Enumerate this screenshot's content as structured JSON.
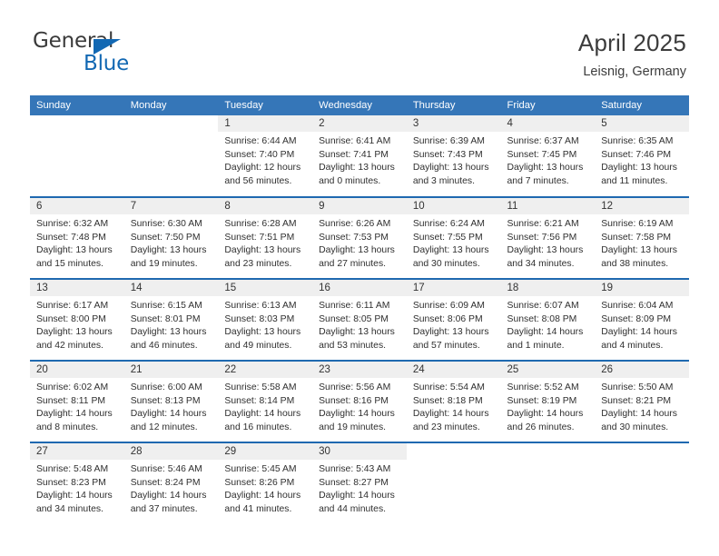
{
  "logo": {
    "word_one": "General",
    "word_two": "Blue",
    "triangle_color": "#1268b3"
  },
  "header": {
    "title": "April 2025",
    "subtitle": "Leisnig, Germany",
    "header_bg": "#3576b8",
    "row_divider_color": "#1f69b0",
    "daynum_bg": "#efefef"
  },
  "weekday_headers": [
    "Sunday",
    "Monday",
    "Tuesday",
    "Wednesday",
    "Thursday",
    "Friday",
    "Saturday"
  ],
  "labels": {
    "sunrise_prefix": "Sunrise:",
    "sunset_prefix": "Sunset:",
    "daylight_prefix": "Daylight:"
  },
  "weeks": [
    [
      {
        "day": "",
        "sunrise": "",
        "sunset": "",
        "daylight_line1": "",
        "daylight_line2": "",
        "empty": true
      },
      {
        "day": "",
        "sunrise": "",
        "sunset": "",
        "daylight_line1": "",
        "daylight_line2": "",
        "empty": true
      },
      {
        "day": "1",
        "sunrise": "Sunrise: 6:44 AM",
        "sunset": "Sunset: 7:40 PM",
        "daylight_line1": "Daylight: 12 hours",
        "daylight_line2": "and 56 minutes."
      },
      {
        "day": "2",
        "sunrise": "Sunrise: 6:41 AM",
        "sunset": "Sunset: 7:41 PM",
        "daylight_line1": "Daylight: 13 hours",
        "daylight_line2": "and 0 minutes."
      },
      {
        "day": "3",
        "sunrise": "Sunrise: 6:39 AM",
        "sunset": "Sunset: 7:43 PM",
        "daylight_line1": "Daylight: 13 hours",
        "daylight_line2": "and 3 minutes."
      },
      {
        "day": "4",
        "sunrise": "Sunrise: 6:37 AM",
        "sunset": "Sunset: 7:45 PM",
        "daylight_line1": "Daylight: 13 hours",
        "daylight_line2": "and 7 minutes."
      },
      {
        "day": "5",
        "sunrise": "Sunrise: 6:35 AM",
        "sunset": "Sunset: 7:46 PM",
        "daylight_line1": "Daylight: 13 hours",
        "daylight_line2": "and 11 minutes."
      }
    ],
    [
      {
        "day": "6",
        "sunrise": "Sunrise: 6:32 AM",
        "sunset": "Sunset: 7:48 PM",
        "daylight_line1": "Daylight: 13 hours",
        "daylight_line2": "and 15 minutes."
      },
      {
        "day": "7",
        "sunrise": "Sunrise: 6:30 AM",
        "sunset": "Sunset: 7:50 PM",
        "daylight_line1": "Daylight: 13 hours",
        "daylight_line2": "and 19 minutes."
      },
      {
        "day": "8",
        "sunrise": "Sunrise: 6:28 AM",
        "sunset": "Sunset: 7:51 PM",
        "daylight_line1": "Daylight: 13 hours",
        "daylight_line2": "and 23 minutes."
      },
      {
        "day": "9",
        "sunrise": "Sunrise: 6:26 AM",
        "sunset": "Sunset: 7:53 PM",
        "daylight_line1": "Daylight: 13 hours",
        "daylight_line2": "and 27 minutes."
      },
      {
        "day": "10",
        "sunrise": "Sunrise: 6:24 AM",
        "sunset": "Sunset: 7:55 PM",
        "daylight_line1": "Daylight: 13 hours",
        "daylight_line2": "and 30 minutes."
      },
      {
        "day": "11",
        "sunrise": "Sunrise: 6:21 AM",
        "sunset": "Sunset: 7:56 PM",
        "daylight_line1": "Daylight: 13 hours",
        "daylight_line2": "and 34 minutes."
      },
      {
        "day": "12",
        "sunrise": "Sunrise: 6:19 AM",
        "sunset": "Sunset: 7:58 PM",
        "daylight_line1": "Daylight: 13 hours",
        "daylight_line2": "and 38 minutes."
      }
    ],
    [
      {
        "day": "13",
        "sunrise": "Sunrise: 6:17 AM",
        "sunset": "Sunset: 8:00 PM",
        "daylight_line1": "Daylight: 13 hours",
        "daylight_line2": "and 42 minutes."
      },
      {
        "day": "14",
        "sunrise": "Sunrise: 6:15 AM",
        "sunset": "Sunset: 8:01 PM",
        "daylight_line1": "Daylight: 13 hours",
        "daylight_line2": "and 46 minutes."
      },
      {
        "day": "15",
        "sunrise": "Sunrise: 6:13 AM",
        "sunset": "Sunset: 8:03 PM",
        "daylight_line1": "Daylight: 13 hours",
        "daylight_line2": "and 49 minutes."
      },
      {
        "day": "16",
        "sunrise": "Sunrise: 6:11 AM",
        "sunset": "Sunset: 8:05 PM",
        "daylight_line1": "Daylight: 13 hours",
        "daylight_line2": "and 53 minutes."
      },
      {
        "day": "17",
        "sunrise": "Sunrise: 6:09 AM",
        "sunset": "Sunset: 8:06 PM",
        "daylight_line1": "Daylight: 13 hours",
        "daylight_line2": "and 57 minutes."
      },
      {
        "day": "18",
        "sunrise": "Sunrise: 6:07 AM",
        "sunset": "Sunset: 8:08 PM",
        "daylight_line1": "Daylight: 14 hours",
        "daylight_line2": "and 1 minute."
      },
      {
        "day": "19",
        "sunrise": "Sunrise: 6:04 AM",
        "sunset": "Sunset: 8:09 PM",
        "daylight_line1": "Daylight: 14 hours",
        "daylight_line2": "and 4 minutes."
      }
    ],
    [
      {
        "day": "20",
        "sunrise": "Sunrise: 6:02 AM",
        "sunset": "Sunset: 8:11 PM",
        "daylight_line1": "Daylight: 14 hours",
        "daylight_line2": "and 8 minutes."
      },
      {
        "day": "21",
        "sunrise": "Sunrise: 6:00 AM",
        "sunset": "Sunset: 8:13 PM",
        "daylight_line1": "Daylight: 14 hours",
        "daylight_line2": "and 12 minutes."
      },
      {
        "day": "22",
        "sunrise": "Sunrise: 5:58 AM",
        "sunset": "Sunset: 8:14 PM",
        "daylight_line1": "Daylight: 14 hours",
        "daylight_line2": "and 16 minutes."
      },
      {
        "day": "23",
        "sunrise": "Sunrise: 5:56 AM",
        "sunset": "Sunset: 8:16 PM",
        "daylight_line1": "Daylight: 14 hours",
        "daylight_line2": "and 19 minutes."
      },
      {
        "day": "24",
        "sunrise": "Sunrise: 5:54 AM",
        "sunset": "Sunset: 8:18 PM",
        "daylight_line1": "Daylight: 14 hours",
        "daylight_line2": "and 23 minutes."
      },
      {
        "day": "25",
        "sunrise": "Sunrise: 5:52 AM",
        "sunset": "Sunset: 8:19 PM",
        "daylight_line1": "Daylight: 14 hours",
        "daylight_line2": "and 26 minutes."
      },
      {
        "day": "26",
        "sunrise": "Sunrise: 5:50 AM",
        "sunset": "Sunset: 8:21 PM",
        "daylight_line1": "Daylight: 14 hours",
        "daylight_line2": "and 30 minutes."
      }
    ],
    [
      {
        "day": "27",
        "sunrise": "Sunrise: 5:48 AM",
        "sunset": "Sunset: 8:23 PM",
        "daylight_line1": "Daylight: 14 hours",
        "daylight_line2": "and 34 minutes."
      },
      {
        "day": "28",
        "sunrise": "Sunrise: 5:46 AM",
        "sunset": "Sunset: 8:24 PM",
        "daylight_line1": "Daylight: 14 hours",
        "daylight_line2": "and 37 minutes."
      },
      {
        "day": "29",
        "sunrise": "Sunrise: 5:45 AM",
        "sunset": "Sunset: 8:26 PM",
        "daylight_line1": "Daylight: 14 hours",
        "daylight_line2": "and 41 minutes."
      },
      {
        "day": "30",
        "sunrise": "Sunrise: 5:43 AM",
        "sunset": "Sunset: 8:27 PM",
        "daylight_line1": "Daylight: 14 hours",
        "daylight_line2": "and 44 minutes."
      },
      {
        "day": "",
        "sunrise": "",
        "sunset": "",
        "daylight_line1": "",
        "daylight_line2": "",
        "empty": true
      },
      {
        "day": "",
        "sunrise": "",
        "sunset": "",
        "daylight_line1": "",
        "daylight_line2": "",
        "empty": true
      },
      {
        "day": "",
        "sunrise": "",
        "sunset": "",
        "daylight_line1": "",
        "daylight_line2": "",
        "empty": true
      }
    ]
  ]
}
